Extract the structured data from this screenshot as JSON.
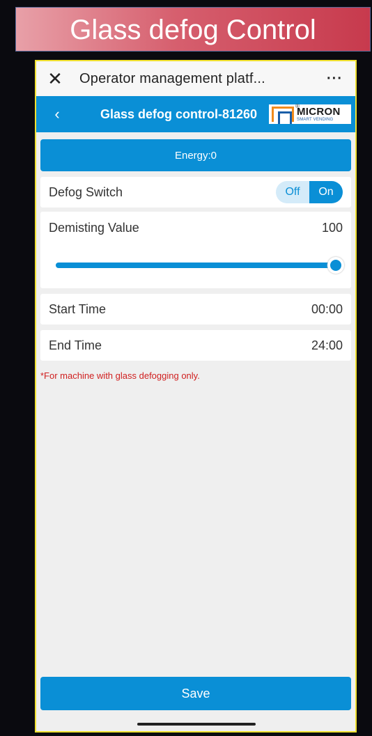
{
  "slide_title": "Glass defog Control",
  "topbar": {
    "close_icon": "close-icon",
    "title": "Operator management platf...",
    "more_icon": "more-icon",
    "more_label": "···"
  },
  "navbar": {
    "back_icon": "chevron-left-icon",
    "title": "Glass defog control-81260",
    "logo_text": "MICRON",
    "logo_sub": "SMART VENDING",
    "logo_reg": "®"
  },
  "energy": {
    "label": "Energy:0"
  },
  "defog_switch": {
    "label": "Defog Switch",
    "off_label": "Off",
    "on_label": "On",
    "selected": "On"
  },
  "demisting": {
    "label": "Demisting Value",
    "value": "100",
    "slider_fraction": 1.0
  },
  "start_time": {
    "label": "Start Time",
    "value": "00:00"
  },
  "end_time": {
    "label": "End Time",
    "value": "24:00"
  },
  "note": "*For machine with glass defogging only.",
  "save_label": "Save",
  "colors": {
    "accent": "#0a8fd6",
    "note": "#d02020",
    "title_bg": "#d65f6e"
  }
}
